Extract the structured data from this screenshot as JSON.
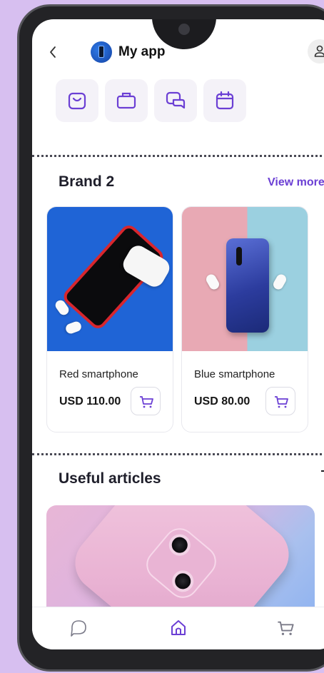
{
  "header": {
    "back_icon": "chevron-left-icon",
    "title": "My app",
    "profile_icon": "user-icon"
  },
  "categories": [
    {
      "icon": "shopping-bag-icon"
    },
    {
      "icon": "briefcase-icon"
    },
    {
      "icon": "chat-icon"
    },
    {
      "icon": "calendar-icon"
    }
  ],
  "brand_section": {
    "title": "Brand 2",
    "view_more_label": "View more",
    "products": [
      {
        "name": "Red smartphone",
        "price": "USD 110.00"
      },
      {
        "name": "Blue smartphone",
        "price": "USD 80.00"
      }
    ]
  },
  "articles_section": {
    "title": "Useful articles"
  },
  "bottom_nav": {
    "items": [
      {
        "icon": "chat-icon"
      },
      {
        "icon": "home-icon",
        "active": true
      },
      {
        "icon": "cart-icon"
      }
    ]
  },
  "colors": {
    "accent": "#6b3fd4",
    "background": "#d7bff0",
    "icon_stroke": "#6b3fd4"
  }
}
